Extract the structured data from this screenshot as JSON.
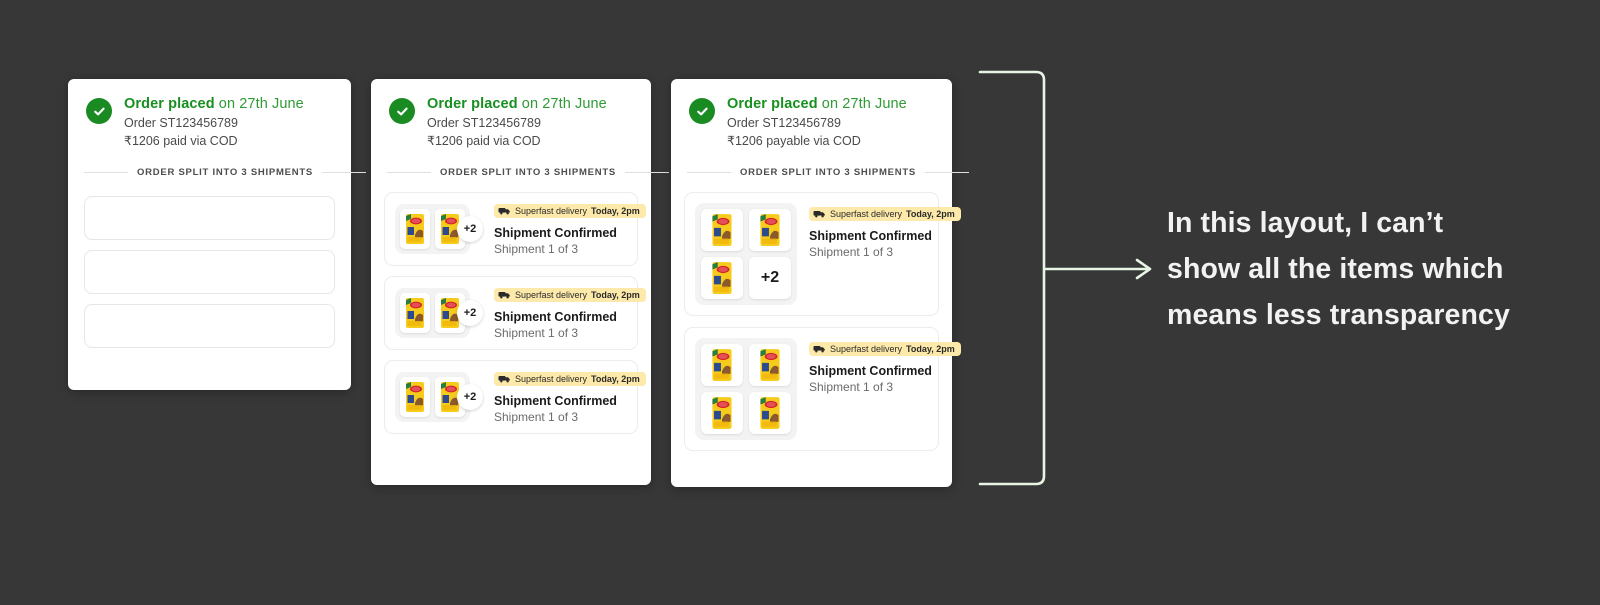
{
  "canvas": {
    "background_color": "#373737"
  },
  "order": {
    "status_title_bold": "Order placed",
    "status_title_rest": " on 27th June",
    "order_id": "Order ST123456789",
    "payment_paid": "₹1206 paid via COD",
    "payment_payable": "₹1206 payable via COD",
    "split_label": "ORDER SPLIT INTO 3 SHIPMENTS",
    "check_icon": "check-circle-icon",
    "accent_green": "#17901f"
  },
  "cards": [
    {
      "id": "card-1",
      "variant": "placeholders",
      "payment": "₹1206 paid via COD",
      "placeholders": [
        {
          "name": "shipment-placeholder-1"
        },
        {
          "name": "shipment-placeholder-2"
        },
        {
          "name": "shipment-placeholder-3"
        }
      ]
    },
    {
      "id": "card-2",
      "variant": "rows",
      "payment": "₹1206 paid via COD",
      "shipments": [
        {
          "badge_prefix": "Superfast delivery ",
          "badge_time": "Today, 2pm",
          "badge_icon": "truck-icon",
          "status": "Shipment Confirmed",
          "count": "Shipment 1 of 3",
          "thumbs": 2,
          "overflow": "+2"
        },
        {
          "badge_prefix": "Superfast delivery ",
          "badge_time": "Today, 2pm",
          "badge_icon": "truck-icon",
          "status": "Shipment Confirmed",
          "count": "Shipment 1 of 3",
          "thumbs": 2,
          "overflow": "+2"
        },
        {
          "badge_prefix": "Superfast delivery ",
          "badge_time": "Today, 2pm",
          "badge_icon": "truck-icon",
          "status": "Shipment Confirmed",
          "count": "Shipment 1 of 3",
          "thumbs": 2,
          "overflow": "+2"
        }
      ]
    },
    {
      "id": "card-3",
      "variant": "grid",
      "payment": "₹1206 payable via COD",
      "shipments": [
        {
          "badge_prefix": "Superfast delivery ",
          "badge_time": "Today, 2pm",
          "badge_icon": "truck-icon",
          "status": "Shipment Confirmed",
          "count": "Shipment 1 of 3",
          "thumbs": 3,
          "overflow": "+2"
        },
        {
          "badge_prefix": "Superfast delivery ",
          "badge_time": "Today, 2pm",
          "badge_icon": "truck-icon",
          "status": "Shipment Confirmed",
          "count": "Shipment 1 of 3",
          "thumbs": 4,
          "overflow": ""
        }
      ]
    }
  ],
  "annotation": {
    "line_1": "In this layout, I can’t",
    "line_2": "show all the items which",
    "line_3": "means less transparency",
    "text_color": "#f2f2f2",
    "connector": "bracket-arrow"
  },
  "product_thumbnail": {
    "name": "snack-packet-thumbnail",
    "packet_color": "#f6c916",
    "logo_color": "#d8222a"
  }
}
